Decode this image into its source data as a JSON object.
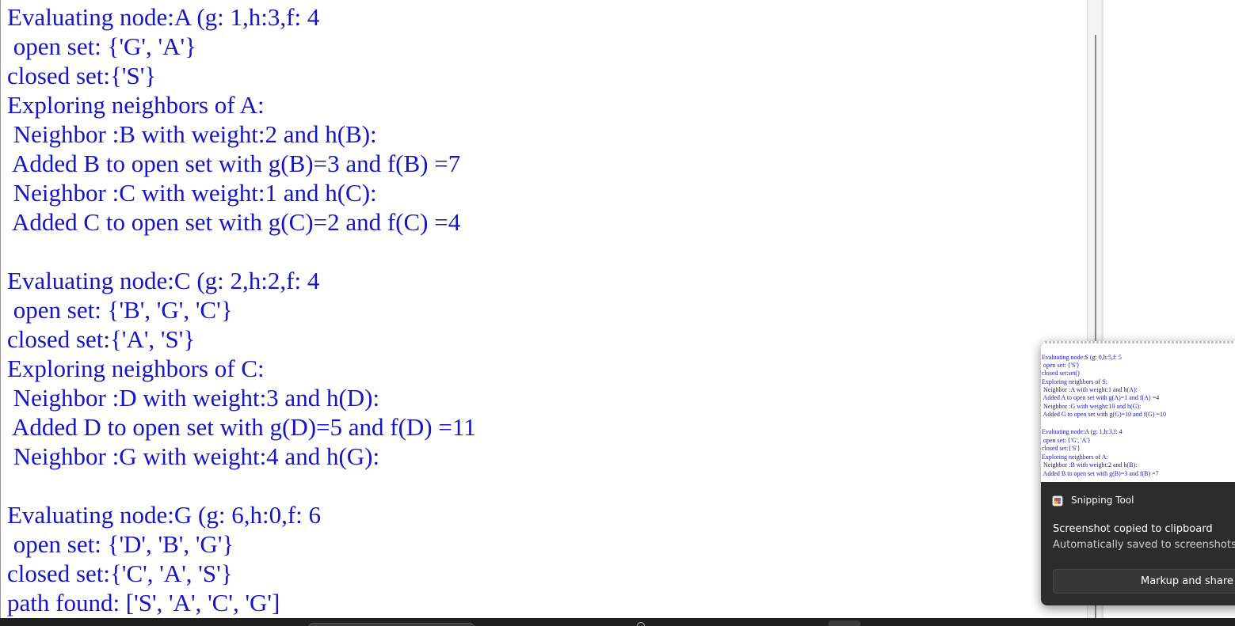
{
  "console_output": {
    "lines": [
      "Evaluating node:A (g: 1,h:3,f: 4",
      " open set: {'G', 'A'}",
      "closed set:{'S'}",
      "Exploring neighbors of A:",
      " Neighbor :B with weight:2 and h(B):",
      " Added B to open set with g(B)=3 and f(B) =7",
      " Neighbor :C with weight:1 and h(C):",
      " Added C to open set with g(C)=2 and f(C) =4",
      "",
      "Evaluating node:C (g: 2,h:2,f: 4",
      " open set: {'B', 'G', 'C'}",
      "closed set:{'A', 'S'}",
      "Exploring neighbors of C:",
      " Neighbor :D with weight:3 and h(D):",
      " Added D to open set with g(D)=5 and f(D) =11",
      " Neighbor :G with weight:4 and h(G):",
      "",
      "Evaluating node:G (g: 6,h:0,f: 6",
      " open set: {'D', 'B', 'G'}",
      "closed set:{'C', 'A', 'S'}",
      "path found: ['S', 'A', 'C', 'G']"
    ]
  },
  "notification": {
    "app_name": "Snipping Tool",
    "title": "Screenshot copied to clipboard",
    "subtitle": "Automatically saved to screenshots fo",
    "action_label": "Markup and share",
    "preview_lines": [
      "Evaluating node:S (g: 0,h:5,f: 5",
      " open set: {'S'}",
      "closed set:set()",
      "Exploring neighbors of S:",
      " Neighbor :A with weight:1 and h(A):",
      " Added A to open set with g(A)=1 and f(A) =4",
      " Neighbor :G with weight:10 and h(G):",
      " Added G to open set with g(G)=10 and f(G) =10",
      "",
      "Evaluating node:A (g: 1,h:3,f: 4",
      " open set: {'G', 'A'}",
      "closed set:{'S'}",
      "Exploring neighbors of A:",
      " Neighbor :B with weight:2 and h(B):",
      " Added B to open set with g(B)=3 and f(B) =7"
    ]
  },
  "colors": {
    "output_text": "#1515c7",
    "toast_background": "#2c2c2c",
    "taskbar": "#1f1f1f"
  }
}
